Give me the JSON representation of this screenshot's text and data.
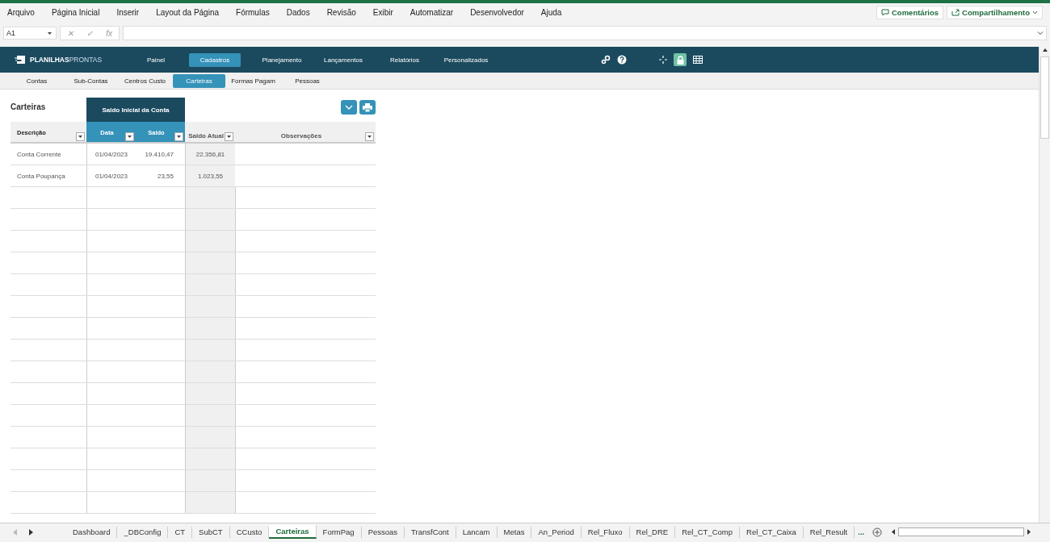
{
  "ribbon": {
    "menu": [
      "Arquivo",
      "Página Inicial",
      "Inserir",
      "Layout da Página",
      "Fórmulas",
      "Dados",
      "Revisão",
      "Exibir",
      "Automatizar",
      "Desenvolvedor",
      "Ajuda"
    ],
    "comments_button": "Comentários",
    "share_button": "Compartilhamento"
  },
  "formula_bar": {
    "name_box": "A1",
    "fx": "fx",
    "cancel": "✕",
    "enter": "✓"
  },
  "app_header": {
    "logo_bold": "PLANILHAS",
    "logo_light": "PRONTAS",
    "nav": [
      {
        "label": "Painel",
        "selected": false
      },
      {
        "label": "Cadastros",
        "selected": true
      },
      {
        "label": "Planejamento",
        "selected": false
      },
      {
        "label": "Lançamentos",
        "selected": false
      },
      {
        "label": "Relatórios",
        "selected": false
      },
      {
        "label": "Personalizados",
        "selected": false
      }
    ],
    "lock_on": true
  },
  "sub_nav": [
    {
      "label": "Contas",
      "selected": false
    },
    {
      "label": "Sub-Contas",
      "selected": false
    },
    {
      "label": "Centros Custo",
      "selected": false
    },
    {
      "label": "Carteiras",
      "selected": true
    },
    {
      "label": "Formas Pagam",
      "selected": false
    },
    {
      "label": "Pessoas",
      "selected": false
    }
  ],
  "table": {
    "title": "Carteiras",
    "group_header": "Saldo Inicial da Conta",
    "columns": [
      "Descrição",
      "Data",
      "Saldo",
      "Saldo Atual",
      "Observações"
    ],
    "rows": [
      [
        "Conta Corrente",
        "01/04/2023",
        "19.410,47",
        "22.356,81",
        ""
      ],
      [
        "Conta Poupança",
        "01/04/2023",
        "23,55",
        "1.023,55",
        ""
      ]
    ]
  },
  "sheet_tabs": [
    {
      "label": "Dashboard",
      "selected": false
    },
    {
      "label": "_DBConfig",
      "selected": false
    },
    {
      "label": "CT",
      "selected": false
    },
    {
      "label": "SubCT",
      "selected": false
    },
    {
      "label": "CCusto",
      "selected": false
    },
    {
      "label": "Carteiras",
      "selected": true
    },
    {
      "label": "FormPag",
      "selected": false
    },
    {
      "label": "Pessoas",
      "selected": false
    },
    {
      "label": "TransfCont",
      "selected": false
    },
    {
      "label": "Lancam",
      "selected": false
    },
    {
      "label": "Metas",
      "selected": false
    },
    {
      "label": "An_Period",
      "selected": false
    },
    {
      "label": "Rel_Fluxo",
      "selected": false
    },
    {
      "label": "Rel_DRE",
      "selected": false
    },
    {
      "label": "Rel_CT_Comp",
      "selected": false
    },
    {
      "label": "Rel_CT_Caixa",
      "selected": false
    },
    {
      "label": "Rel_Result",
      "selected": false
    }
  ],
  "more_tabs": "..."
}
